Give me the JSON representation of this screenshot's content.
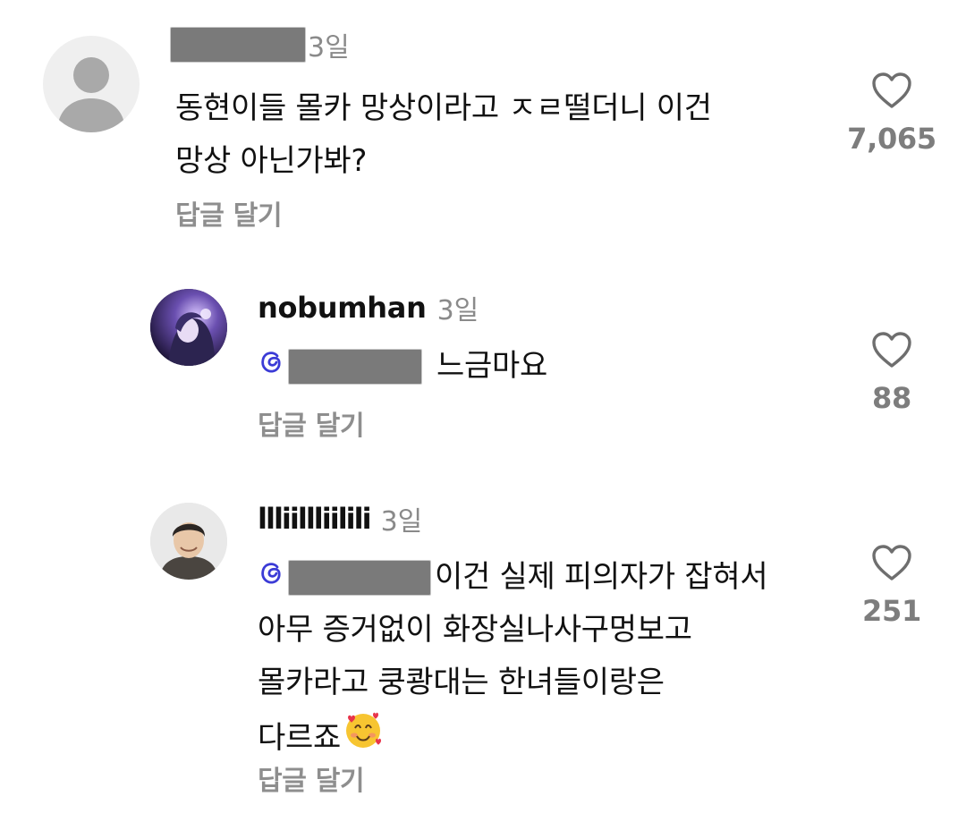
{
  "comments": [
    {
      "author": "",
      "author_redacted": true,
      "time": "3일",
      "lines": [
        "동현이들 몰카 망상이라고 ㅈㄹ떨더니 이건",
        "망상 아닌가봐?"
      ],
      "reply_label": "답글 달기",
      "likes": "7,065",
      "avatar": "default-avatar"
    },
    {
      "author": "nobumhan",
      "time": "3일",
      "mention_redacted": true,
      "lines": [
        "느금마요"
      ],
      "reply_label": "답글 달기",
      "likes": "88",
      "avatar": "anime-character-avatar"
    },
    {
      "author": "llliillliilili",
      "time": "3일",
      "mention_redacted": true,
      "lines": [
        "이건 실제 피의자가 잡혀서",
        "아무 증거없이 화장실나사구멍보고",
        "몰카라고 쿵쾅대는 한녀들이랑은",
        "다르죠"
      ],
      "emoji": "smiling-face-with-hearts",
      "reply_label": "답글 달기",
      "likes": "251",
      "avatar": "person-photo-avatar"
    }
  ],
  "icons": {
    "like": "heart-outline-icon",
    "mention": "threads-mention-icon"
  },
  "colors": {
    "secondary_text": "#8e8e8e",
    "redaction": "#7a7a7a",
    "mention": "#3b3bd6"
  }
}
